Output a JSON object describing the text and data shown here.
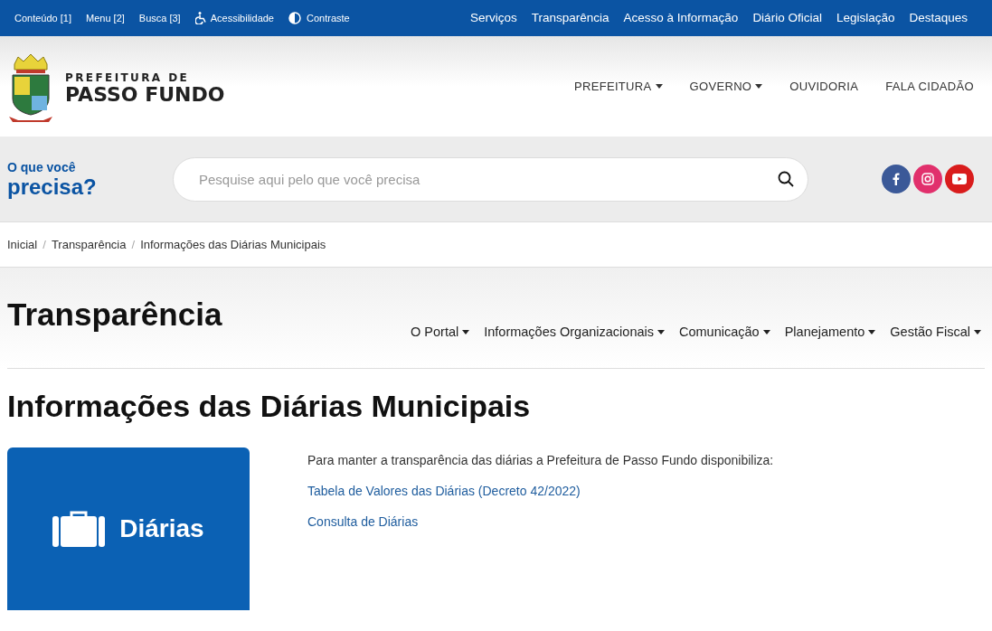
{
  "top_bar": {
    "left": [
      {
        "label": "Conteúdo [1]",
        "kind": "link"
      },
      {
        "label": "Menu [2]",
        "kind": "link"
      },
      {
        "label": "Busca [3]",
        "kind": "link"
      },
      {
        "label": "Acessibilidade",
        "kind": "accessibility"
      },
      {
        "label": "Contraste",
        "kind": "contrast"
      }
    ],
    "right": [
      "Serviços",
      "Transparência",
      "Acesso à Informação",
      "Diário Oficial",
      "Legislação",
      "Destaques"
    ]
  },
  "header": {
    "logo_small": "PREFEITURA DE",
    "logo_large": "PASSO FUNDO",
    "nav": [
      {
        "label": "PREFEITURA",
        "dropdown": true
      },
      {
        "label": "GOVERNO",
        "dropdown": true
      },
      {
        "label": "OUVIDORIA",
        "dropdown": false
      },
      {
        "label": "FALA CIDADÃO",
        "dropdown": false
      }
    ]
  },
  "search": {
    "prompt_small": "O que você",
    "prompt_large": "precisa?",
    "placeholder": "Pesquise aqui pelo que você precisa",
    "social": [
      {
        "kind": "facebook"
      },
      {
        "kind": "instagram"
      },
      {
        "kind": "youtube"
      }
    ]
  },
  "breadcrumb": {
    "separator": "/",
    "items": [
      "Inicial",
      "Transparência",
      "Informações das Diárias Municipais"
    ]
  },
  "section": {
    "title": "Transparência",
    "menu": [
      {
        "label": "O Portal",
        "dropdown": true
      },
      {
        "label": "Informações Organizacionais",
        "dropdown": true
      },
      {
        "label": "Comunicação",
        "dropdown": true
      },
      {
        "label": "Planejamento",
        "dropdown": true
      },
      {
        "label": "Gestão Fiscal",
        "dropdown": true
      }
    ]
  },
  "page": {
    "title": "Informações das Diárias Municipais",
    "banner_label": "Diárias",
    "intro": "Para manter a transparência das diárias a Prefeitura de Passo Fundo disponibiliza:",
    "links": [
      "Tabela de Valores das Diárias (Decreto 42/2022)",
      "Consulta de Diárias"
    ]
  }
}
